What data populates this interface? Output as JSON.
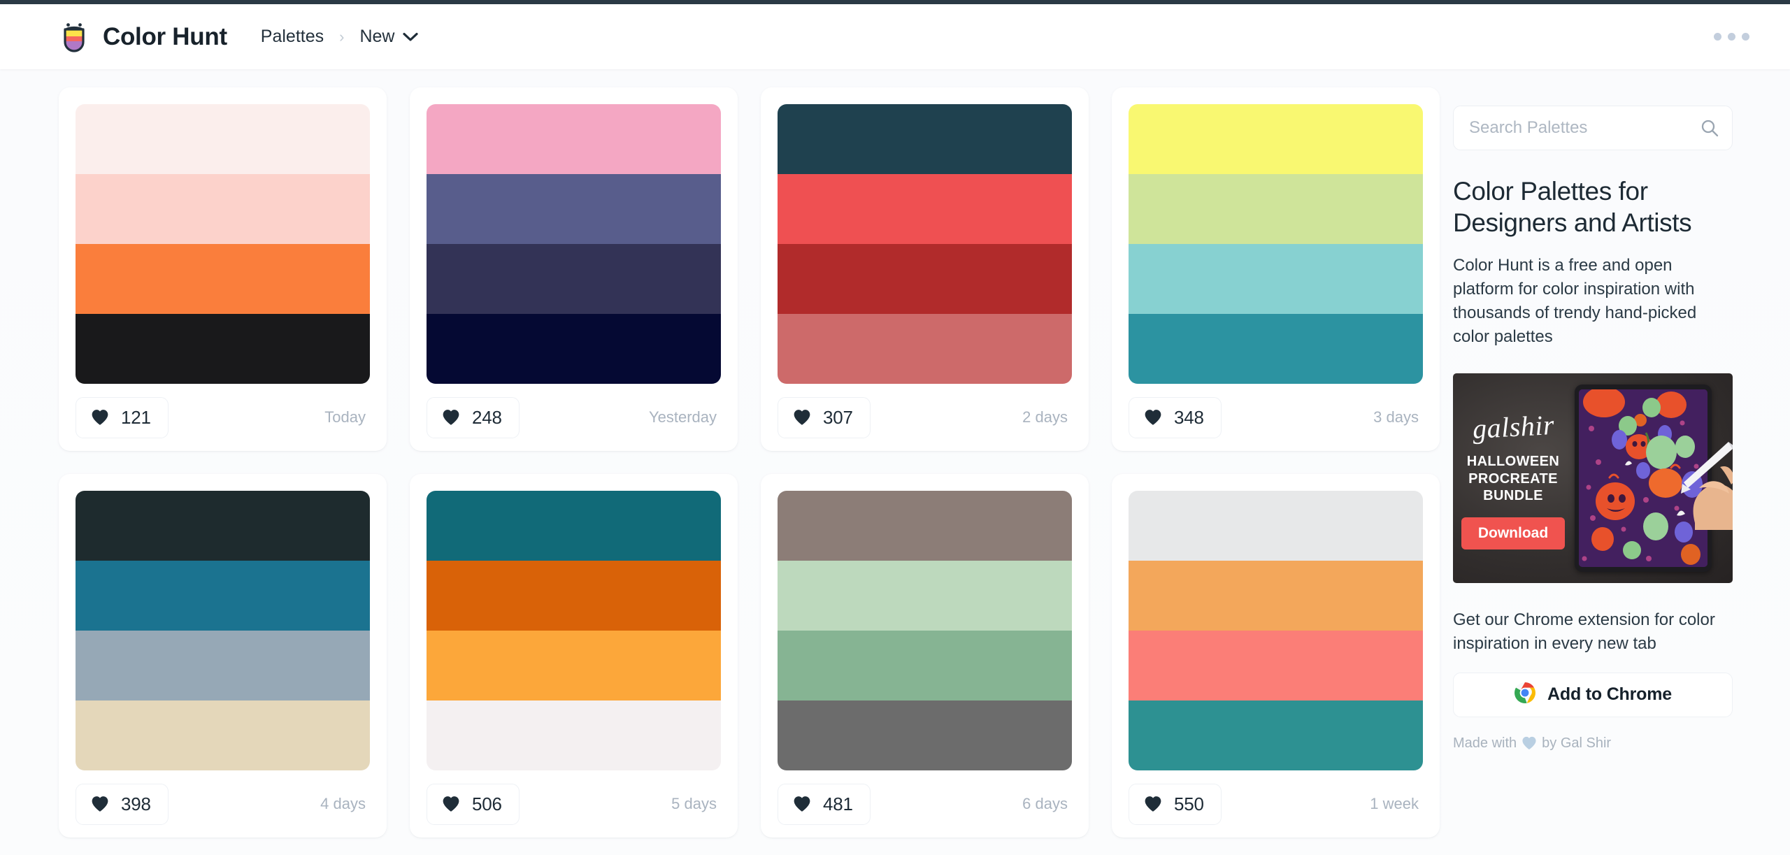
{
  "header": {
    "brand_name": "Color Hunt",
    "logo_icon": "color-hunt-logo",
    "breadcrumb": {
      "root": "Palettes",
      "separator": "›",
      "current": "New",
      "chevron_icon": "chevron-down-icon"
    },
    "more_menu_icon": "more-horizontal-icon"
  },
  "palettes": [
    {
      "colors": [
        "#FBEEEC",
        "#FCD2CB",
        "#FA7E3C",
        "#19191B"
      ],
      "likes": "121",
      "date": "Today",
      "heart_icon": "heart-icon"
    },
    {
      "colors": [
        "#F4A7C3",
        "#585D8C",
        "#333356",
        "#050933"
      ],
      "likes": "248",
      "date": "Yesterday",
      "heart_icon": "heart-icon"
    },
    {
      "colors": [
        "#1F414F",
        "#EF5052",
        "#B12B2B",
        "#CD6A6A"
      ],
      "likes": "307",
      "date": "2 days",
      "heart_icon": "heart-icon"
    },
    {
      "colors": [
        "#F9F871",
        "#CFE49A",
        "#87D1D1",
        "#2C93A1"
      ],
      "likes": "348",
      "date": "3 days",
      "heart_icon": "heart-icon"
    },
    {
      "colors": [
        "#1E2B2E",
        "#1B7390",
        "#96A8B6",
        "#E4D7BA"
      ],
      "likes": "398",
      "date": "4 days",
      "heart_icon": "heart-icon"
    },
    {
      "colors": [
        "#116A78",
        "#D96208",
        "#FCA73A",
        "#F4F0F1"
      ],
      "likes": "506",
      "date": "5 days",
      "heart_icon": "heart-icon"
    },
    {
      "colors": [
        "#8C7D77",
        "#BDD9BD",
        "#86B493",
        "#6C6C6C"
      ],
      "likes": "481",
      "date": "6 days",
      "heart_icon": "heart-icon"
    },
    {
      "colors": [
        "#E7E8E9",
        "#F3A75B",
        "#FB7E77",
        "#2D9192"
      ],
      "likes": "550",
      "date": "1 week",
      "heart_icon": "heart-icon"
    }
  ],
  "sidebar": {
    "search": {
      "placeholder": "Search Palettes",
      "value": "",
      "icon": "search-icon"
    },
    "title": "Color Palettes for Designers and Artists",
    "description": "Color Hunt is a free and open platform for color inspiration with thousands of trendy hand-picked color palettes",
    "ad": {
      "brand": "galshir",
      "headline": "HALLOWEEN PROCREATE BUNDLE",
      "button_label": "Download",
      "button_color": "#F0534F"
    },
    "extension": {
      "text": "Get our Chrome extension for color inspiration in every new tab",
      "button_label": "Add to Chrome",
      "button_icon": "chrome-icon"
    },
    "footer": {
      "prefix": "Made with",
      "heart_icon": "heart-icon",
      "suffix": "by Gal Shir"
    }
  }
}
